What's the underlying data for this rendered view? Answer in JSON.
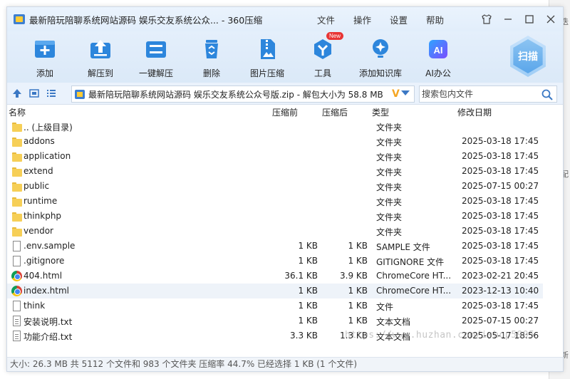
{
  "window": {
    "title": "最新陪玩陪聊系统网站源码 娱乐交友系统公众... - 360压缩",
    "menu": [
      "文件",
      "操作",
      "设置",
      "帮助"
    ]
  },
  "toolbar": {
    "buttons": [
      {
        "label": "添加",
        "icon": "add-icon"
      },
      {
        "label": "解压到",
        "icon": "extract-to-icon"
      },
      {
        "label": "一键解压",
        "icon": "one-click-extract-icon"
      },
      {
        "label": "删除",
        "icon": "trash-icon"
      },
      {
        "label": "图片压缩",
        "icon": "image-compress-icon"
      },
      {
        "label": "工具",
        "icon": "tools-icon",
        "badge": "New"
      },
      {
        "label": "添加知识库",
        "icon": "knowledge-base-icon"
      },
      {
        "label": "AI办公",
        "icon": "ai-office-icon",
        "icon_text": "AI"
      }
    ],
    "scan_label": "扫描"
  },
  "address": {
    "path": "最新陪玩陪聊系统网站源码 娱乐交友系统公众号版.zip - 解包大小为 58.8 MB",
    "search_placeholder": "搜索包内文件"
  },
  "columns": {
    "name": "名称",
    "size": "压缩前",
    "compressed": "压缩后",
    "type": "类型",
    "modified": "修改日期"
  },
  "files": [
    {
      "name": ".. (上级目录)",
      "size": "",
      "compressed": "",
      "type": "文件夹",
      "modified": "",
      "icon": "folder"
    },
    {
      "name": "addons",
      "size": "",
      "compressed": "",
      "type": "文件夹",
      "modified": "2025-03-18 17:45",
      "icon": "folder"
    },
    {
      "name": "application",
      "size": "",
      "compressed": "",
      "type": "文件夹",
      "modified": "2025-03-18 17:45",
      "icon": "folder"
    },
    {
      "name": "extend",
      "size": "",
      "compressed": "",
      "type": "文件夹",
      "modified": "2025-03-18 17:45",
      "icon": "folder"
    },
    {
      "name": "public",
      "size": "",
      "compressed": "",
      "type": "文件夹",
      "modified": "2025-07-15 00:27",
      "icon": "folder"
    },
    {
      "name": "runtime",
      "size": "",
      "compressed": "",
      "type": "文件夹",
      "modified": "2025-03-18 17:45",
      "icon": "folder"
    },
    {
      "name": "thinkphp",
      "size": "",
      "compressed": "",
      "type": "文件夹",
      "modified": "2025-03-18 17:45",
      "icon": "folder"
    },
    {
      "name": "vendor",
      "size": "",
      "compressed": "",
      "type": "文件夹",
      "modified": "2025-03-18 17:45",
      "icon": "folder"
    },
    {
      "name": ".env.sample",
      "size": "1 KB",
      "compressed": "1 KB",
      "type": "SAMPLE 文件",
      "modified": "2025-03-18 17:45",
      "icon": "doc"
    },
    {
      "name": ".gitignore",
      "size": "1 KB",
      "compressed": "1 KB",
      "type": "GITIGNORE 文件",
      "modified": "2025-03-18 17:45",
      "icon": "doc"
    },
    {
      "name": "404.html",
      "size": "36.1 KB",
      "compressed": "3.9 KB",
      "type": "ChromeCore HT...",
      "modified": "2023-02-21 20:45",
      "icon": "chrome"
    },
    {
      "name": "index.html",
      "size": "1 KB",
      "compressed": "1 KB",
      "type": "ChromeCore HT...",
      "modified": "2023-12-13 10:40",
      "icon": "chrome",
      "selected": true
    },
    {
      "name": "think",
      "size": "1 KB",
      "compressed": "1 KB",
      "type": "文件",
      "modified": "2025-03-18 17:45",
      "icon": "doc"
    },
    {
      "name": "安装说明.txt",
      "size": "1 KB",
      "compressed": "1 KB",
      "type": "文本文档",
      "modified": "2025-07-15 00:27",
      "icon": "txt"
    },
    {
      "name": "功能介绍.txt",
      "size": "3.3 KB",
      "compressed": "1.3 KB",
      "type": "文本文档",
      "modified": "2025-05-17 18:56",
      "icon": "txt"
    }
  ],
  "status": "大小: 26.3 MB 共 5112 个文件和 983 个文件夹 压缩率 44.7% 已经选择 1 KB (1 个文件)",
  "watermark": "https://www.huzhan.com/ishop5995",
  "background_fragments": [
    "迭",
    "配",
    "新"
  ]
}
